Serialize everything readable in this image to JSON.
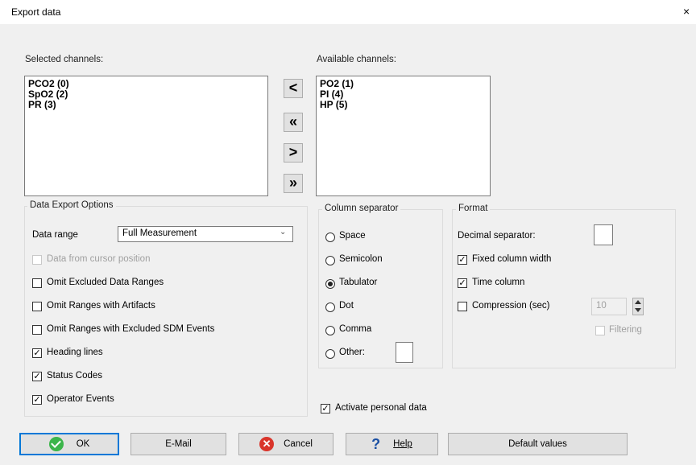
{
  "window": {
    "title": "Export data",
    "close_glyph": "×"
  },
  "selected": {
    "label": "Selected channels:",
    "items": [
      "PCO2 (0)",
      "SpO2 (2)",
      "PR (3)"
    ]
  },
  "available": {
    "label": "Available channels:",
    "items": [
      "PO2 (1)",
      "PI (4)",
      "HP (5)"
    ]
  },
  "arrows": {
    "move_left": "<",
    "move_all_left": "«",
    "move_right": ">",
    "move_all_right": "»"
  },
  "options": {
    "title": "Data Export Options",
    "data_range_label": "Data range",
    "data_range_value": "Full Measurement",
    "data_from_cursor": {
      "label": "Data from cursor position",
      "checked": false,
      "enabled": false
    },
    "omit_excluded": {
      "label": "Omit Excluded Data Ranges",
      "checked": false
    },
    "omit_artifacts": {
      "label": "Omit Ranges with Artifacts",
      "checked": false
    },
    "omit_sdm": {
      "label": "Omit Ranges with Excluded SDM Events",
      "checked": false
    },
    "heading_lines": {
      "label": "Heading lines",
      "checked": true
    },
    "status_codes": {
      "label": "Status Codes",
      "checked": true
    },
    "operator_events": {
      "label": "Operator Events",
      "checked": true
    }
  },
  "separator": {
    "title": "Column separator",
    "options": [
      "Space",
      "Semicolon",
      "Tabulator",
      "Dot",
      "Comma",
      "Other:"
    ],
    "selected": "Tabulator",
    "other_value": ""
  },
  "format": {
    "title": "Format",
    "decimal_label": "Decimal separator:",
    "decimal_value": "",
    "fixed_width": {
      "label": "Fixed column width",
      "checked": true
    },
    "time_column": {
      "label": "Time column",
      "checked": true
    },
    "compression": {
      "label": "Compression (sec)",
      "checked": false,
      "value": "10"
    },
    "filtering": {
      "label": "Filtering",
      "checked": false,
      "enabled": false
    }
  },
  "personal_data": {
    "label": "Activate personal data",
    "checked": true
  },
  "buttons": {
    "ok": "OK",
    "email": "E-Mail",
    "cancel": "Cancel",
    "help": "Help",
    "defaults": "Default values"
  },
  "colors": {
    "ok_icon": "#3bb54a",
    "cancel_icon": "#d9352b",
    "help_icon": "#1a4fa3",
    "focus_border": "#0078d7"
  }
}
